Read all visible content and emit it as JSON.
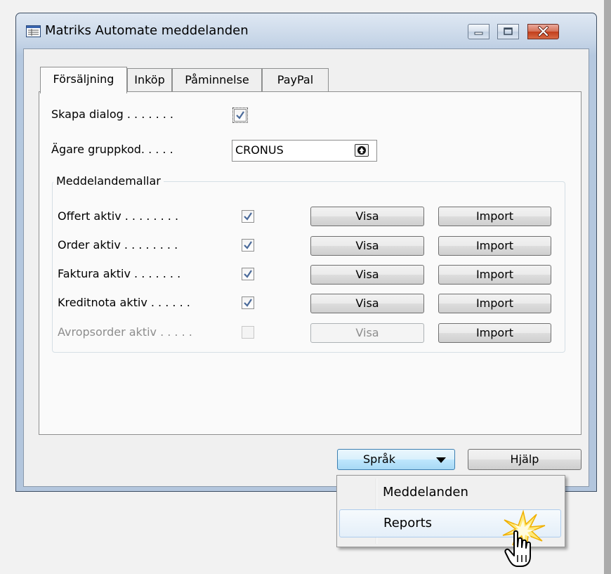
{
  "window": {
    "title": "Matriks Automate meddelanden"
  },
  "tabs": [
    {
      "label": "Försäljning",
      "active": true
    },
    {
      "label": "Inköp",
      "active": false
    },
    {
      "label": "Påminnelse",
      "active": false
    },
    {
      "label": "PayPal",
      "active": false
    }
  ],
  "form": {
    "skapa_dialog": {
      "label": "Skapa dialog . . . . . . .",
      "checked": true
    },
    "agare_gruppkod": {
      "label": "Ägare gruppkod. . . . .",
      "value": "CRONUS"
    }
  },
  "group": {
    "title": "Meddelandemallar",
    "rows": [
      {
        "label": "Offert aktiv . . . . . . . .",
        "checked": true,
        "enabled": true,
        "visa": "Visa",
        "import": "Import"
      },
      {
        "label": "Order aktiv . . . . . . . .",
        "checked": true,
        "enabled": true,
        "visa": "Visa",
        "import": "Import"
      },
      {
        "label": "Faktura aktiv . . . . . . .",
        "checked": true,
        "enabled": true,
        "visa": "Visa",
        "import": "Import"
      },
      {
        "label": "Kreditnota aktiv . . . . . .",
        "checked": true,
        "enabled": true,
        "visa": "Visa",
        "import": "Import"
      },
      {
        "label": "Avropsorder aktiv . . . . .",
        "checked": false,
        "enabled": false,
        "visa": "Visa",
        "import": "Import"
      }
    ]
  },
  "buttons": {
    "sprak": "Språk",
    "hjalp": "Hjälp"
  },
  "menu": {
    "items": [
      {
        "label": "Meddelanden",
        "highlighted": false
      },
      {
        "label": "Reports",
        "highlighted": true
      }
    ]
  },
  "icons": {
    "app": "form-window-icon",
    "dropdown": "triangle-down-icon",
    "lookup": "arrow-up-lookup-icon",
    "cursor": "hand-pointer-icon",
    "click": "click-burst-icon"
  }
}
